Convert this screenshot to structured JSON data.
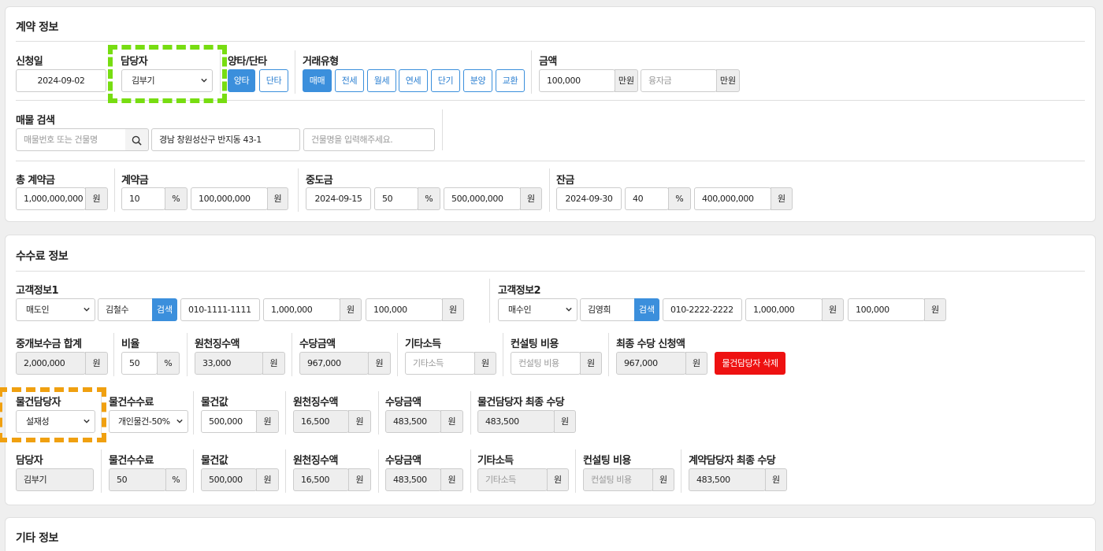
{
  "contract": {
    "title": "계약 정보",
    "applyDate": {
      "label": "신청일",
      "value": "2024-09-02"
    },
    "manager": {
      "label": "담당자",
      "value": "김부기"
    },
    "side": {
      "label": "양타/단타",
      "options": [
        "양타",
        "단타"
      ],
      "selected": "양타"
    },
    "dealType": {
      "label": "거래유형",
      "options": [
        "매매",
        "전세",
        "월세",
        "연세",
        "단기",
        "분양",
        "교환"
      ],
      "selected": "매매"
    },
    "amount": {
      "label": "금액",
      "value": "100,000",
      "unit": "만원",
      "loan_placeholder": "융자금",
      "loan_unit": "만원"
    },
    "property": {
      "label": "매물 검색",
      "search_placeholder": "매물번호 또는 건물명",
      "address": "경남 창원성산구 반지동 43-1",
      "building_placeholder": "건물명을 입력해주세요."
    },
    "total": {
      "label": "총 계약금",
      "value": "1,000,000,000",
      "unit": "원"
    },
    "deposit": {
      "label": "계약금",
      "rate": "10",
      "pct": "%",
      "amount": "100,000,000",
      "unit": "원"
    },
    "middle": {
      "label": "중도금",
      "date": "2024-09-15",
      "rate": "50",
      "pct": "%",
      "amount": "500,000,000",
      "unit": "원"
    },
    "balance": {
      "label": "잔금",
      "date": "2024-09-30",
      "rate": "40",
      "pct": "%",
      "amount": "400,000,000",
      "unit": "원"
    }
  },
  "fee": {
    "title": "수수료 정보",
    "customer1": {
      "label": "고객정보1",
      "role": "매도인",
      "name": "김철수",
      "search": "검색",
      "phone": "010-1111-1111",
      "amount1": "1,000,000",
      "amount2": "100,000",
      "unit": "원"
    },
    "customer2": {
      "label": "고객정보2",
      "role": "매수인",
      "name": "김영희",
      "search": "검색",
      "phone": "010-2222-2222",
      "amount1": "1,000,000",
      "amount2": "100,000",
      "unit": "원"
    },
    "summary": {
      "total": {
        "label": "중개보수금 합계",
        "value": "2,000,000",
        "unit": "원"
      },
      "ratio": {
        "label": "비율",
        "value": "50",
        "unit": "%"
      },
      "withholding": {
        "label": "원천징수액",
        "value": "33,000",
        "unit": "원"
      },
      "allowance": {
        "label": "수당금액",
        "value": "967,000",
        "unit": "원"
      },
      "other": {
        "label": "기타소득",
        "placeholder": "기타소득",
        "unit": "원"
      },
      "consult": {
        "label": "컨설팅 비용",
        "placeholder": "컨설팅 비용",
        "unit": "원"
      },
      "final": {
        "label": "최종 수당 신청액",
        "value": "967,000",
        "unit": "원"
      },
      "delete": "물건담당자 삭제"
    },
    "propertyManager": {
      "manager": {
        "label": "물건담당자",
        "value": "설재성"
      },
      "fee": {
        "label": "물건수수료",
        "value": "개인물건-50%"
      },
      "price": {
        "label": "물건값",
        "value": "500,000",
        "unit": "원"
      },
      "withholding": {
        "label": "원천징수액",
        "value": "16,500",
        "unit": "원"
      },
      "allowance": {
        "label": "수당금액",
        "value": "483,500",
        "unit": "원"
      },
      "final": {
        "label": "물건담당자 최종 수당",
        "value": "483,500",
        "unit": "원"
      }
    },
    "contractManager": {
      "manager": {
        "label": "담당자",
        "value": "김부기"
      },
      "fee": {
        "label": "물건수수료",
        "value": "50",
        "unit": "%"
      },
      "price": {
        "label": "물건값",
        "value": "500,000",
        "unit": "원"
      },
      "withholding": {
        "label": "원천징수액",
        "value": "16,500",
        "unit": "원"
      },
      "allowance": {
        "label": "수당금액",
        "value": "483,500",
        "unit": "원"
      },
      "other": {
        "label": "기타소득",
        "placeholder": "기타소득",
        "unit": "원"
      },
      "consult": {
        "label": "컨설팅 비용",
        "placeholder": "컨설팅 비용",
        "unit": "원"
      },
      "final": {
        "label": "계약담당자 최종 수당",
        "value": "483,500",
        "unit": "원"
      }
    }
  },
  "etc": {
    "title": "기타 정보"
  },
  "colors": {
    "accent": "#3b8fdc",
    "delete": "#ee1111",
    "highlight_green": "#77dd11",
    "highlight_orange": "#f0a010"
  }
}
